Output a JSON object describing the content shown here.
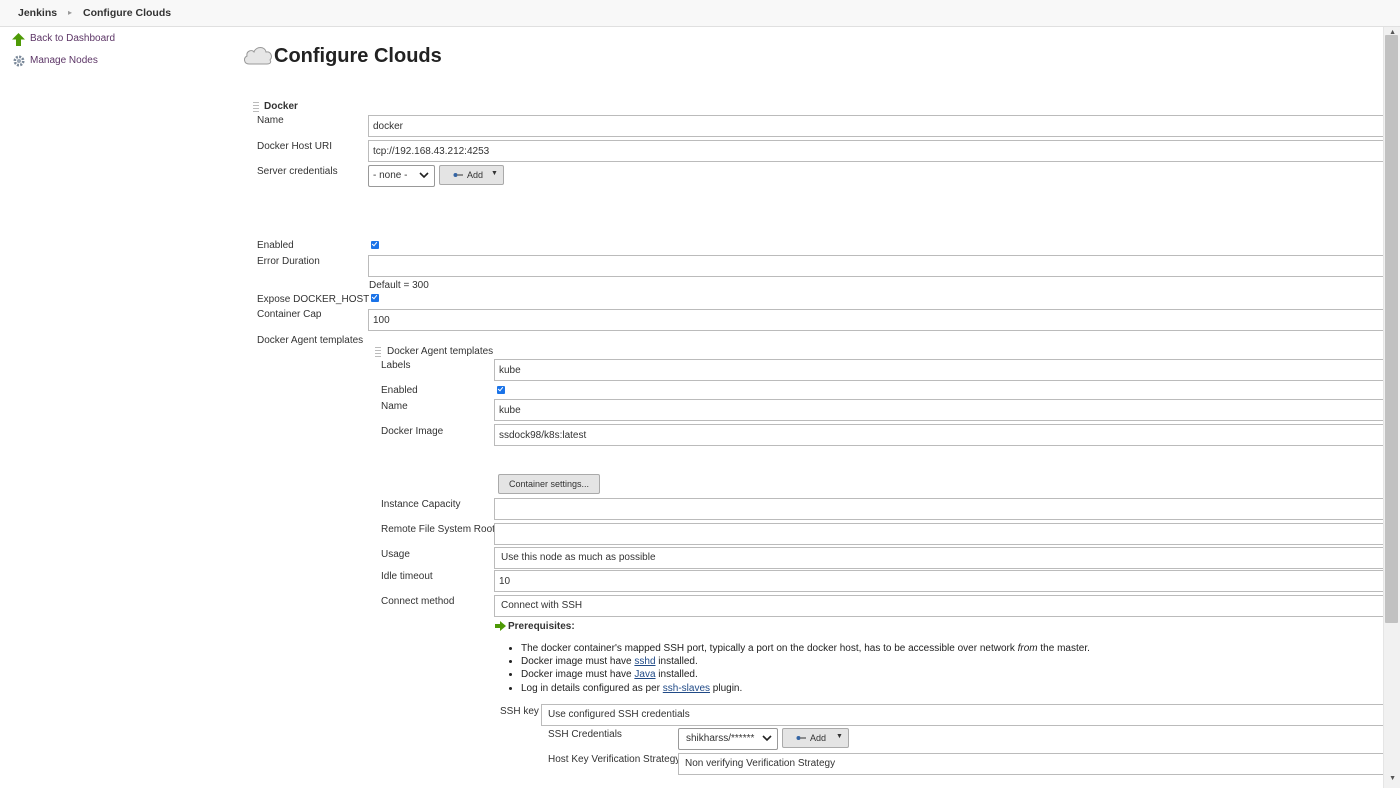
{
  "breadcrumb": {
    "items": [
      "Jenkins",
      "Configure Clouds"
    ]
  },
  "sidebar": {
    "items": [
      {
        "label": "Back to Dashboard",
        "icon": "up-arrow-icon"
      },
      {
        "label": "Manage Nodes",
        "icon": "gear-icon"
      }
    ]
  },
  "page": {
    "title": "Configure Clouds"
  },
  "docker": {
    "section_title": "Docker",
    "name_label": "Name",
    "name_value": "docker",
    "host_uri_label": "Docker Host URI",
    "host_uri_value": "tcp://192.168.43.212:4253",
    "server_credentials_label": "Server credentials",
    "server_credentials_value": "- none -",
    "add_label": "Add",
    "enabled_label": "Enabled",
    "error_duration_label": "Error Duration",
    "error_duration_value": "",
    "error_duration_default": "Default = 300",
    "expose_label": "Expose DOCKER_HOST",
    "container_cap_label": "Container Cap",
    "container_cap_value": "100",
    "agent_templates_label": "Docker Agent templates"
  },
  "template": {
    "section_title": "Docker Agent templates",
    "labels_label": "Labels",
    "labels_value": "kube",
    "enabled_label": "Enabled",
    "name_label": "Name",
    "name_value": "kube",
    "image_label": "Docker Image",
    "image_value": "ssdock98/k8s:latest",
    "container_settings_label": "Container settings...",
    "instance_capacity_label": "Instance Capacity",
    "instance_capacity_value": "",
    "remote_fs_label": "Remote File System Root",
    "remote_fs_value": "",
    "usage_label": "Usage",
    "usage_value": "Use this node as much as possible",
    "idle_timeout_label": "Idle timeout",
    "idle_timeout_value": "10",
    "connect_method_label": "Connect method",
    "connect_method_value": "Connect with SSH"
  },
  "prereq": {
    "title": "Prerequisites:",
    "item1_pre": "The docker container's mapped SSH port, typically a port on the docker host, has to be accessible over network ",
    "item1_em": "from",
    "item1_post": " the master.",
    "item2_pre": "Docker image must have ",
    "item2_link": "sshd",
    "item2_post": " installed.",
    "item3_pre": "Docker image must have ",
    "item3_link": "Java",
    "item3_post": " installed.",
    "item4_pre": "Log in details configured as per ",
    "item4_link": "ssh-slaves",
    "item4_post": " plugin."
  },
  "ssh": {
    "key_label": "SSH key",
    "key_value": "Use configured SSH credentials",
    "credentials_label": "SSH Credentials",
    "credentials_value": "shikharss/******",
    "add_label": "Add",
    "host_key_label": "Host Key Verification Strategy",
    "host_key_value": "Non verifying Verification Strategy"
  },
  "colors": {
    "link": "#5c3566",
    "checkbox": "#1a73e8",
    "arrow_green": "#4e9a06"
  }
}
